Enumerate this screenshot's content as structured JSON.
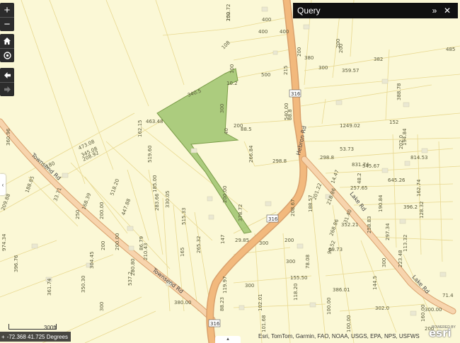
{
  "query_panel": {
    "title": "Query",
    "collapse_icon": "double-chevron-down-icon",
    "close_icon": "close-icon"
  },
  "controls": {
    "zoom_in": "+",
    "zoom_out": "−",
    "home": "home-icon",
    "locate": "locate-icon",
    "back": "arrow-left-icon",
    "forward": "arrow-right-icon"
  },
  "coordinates": "-72.368 41.725 Degrees",
  "scale_label": "300ft",
  "attribution": "Esri, TomTom, Garmin, FAO, NOAA, USGS, EPA, NPS, USFWS",
  "esri_logo": "esri",
  "esri_powered": "POWERED BY",
  "colors": {
    "background": "#fbf8d6",
    "parcel_fill": "#9dc46e",
    "road": "#f2b97d",
    "lines": "#e8d890"
  },
  "roads": [
    {
      "label": "Townsend Rd"
    },
    {
      "label": "Townsend Rd"
    },
    {
      "label": "Hebron Rd"
    },
    {
      "label": "Lake Rd"
    },
    {
      "label": "Lake Rd"
    }
  ],
  "shields": [
    "316",
    "316",
    "316"
  ],
  "dimension_labels": [
    "250",
    "400",
    "400",
    "400",
    "200",
    "200",
    "200",
    "380",
    "382",
    "485",
    "500",
    "215",
    "300",
    "359.57",
    "388.78",
    "100",
    "10.2",
    "340.5",
    "108",
    "300",
    "40",
    "200",
    "88.5",
    "540.00",
    "1249.02",
    "152",
    "463.48",
    "473.08",
    "345.08",
    "208.92",
    "180",
    "360.96",
    "188.85",
    "209.88",
    "33.71",
    "168.39",
    "447.88",
    "518.20",
    "162.15",
    "519.60",
    "185.00",
    "283.66",
    "330.05",
    "515.33",
    "200.00",
    "250",
    "200",
    "165",
    "200.00",
    "86.79",
    "210.43",
    "280.80",
    "304.45",
    "974.34",
    "396.76",
    "361.74",
    "350.30",
    "537.2",
    "300",
    "380.00",
    "265.32",
    "147",
    "29.85",
    "300",
    "200",
    "300",
    "300",
    "88.23",
    "119.97",
    "102.01",
    "101.68",
    "100.00",
    "100.00",
    "88.8",
    "266.84",
    "298.8",
    "298.8",
    "53.73",
    "831.74",
    "545.67",
    "645.26",
    "814.53",
    "14.47",
    "201.22",
    "218.86",
    "257.65",
    "48.2",
    "190.84",
    "352.21",
    "258.83",
    "188.57",
    "208.67",
    "31.40",
    "268.86",
    "78.08",
    "69.73",
    "90.52",
    "155.50",
    "118.20",
    "300",
    "113.32",
    "297.34",
    "223.48",
    "71.4",
    "144.5",
    "302.0",
    "202.0",
    "162.74",
    "128.32",
    "396.2",
    "194.84",
    "200.00",
    "378.72",
    "386.01",
    "160.00",
    "300.00",
    "200",
    "102.72"
  ]
}
